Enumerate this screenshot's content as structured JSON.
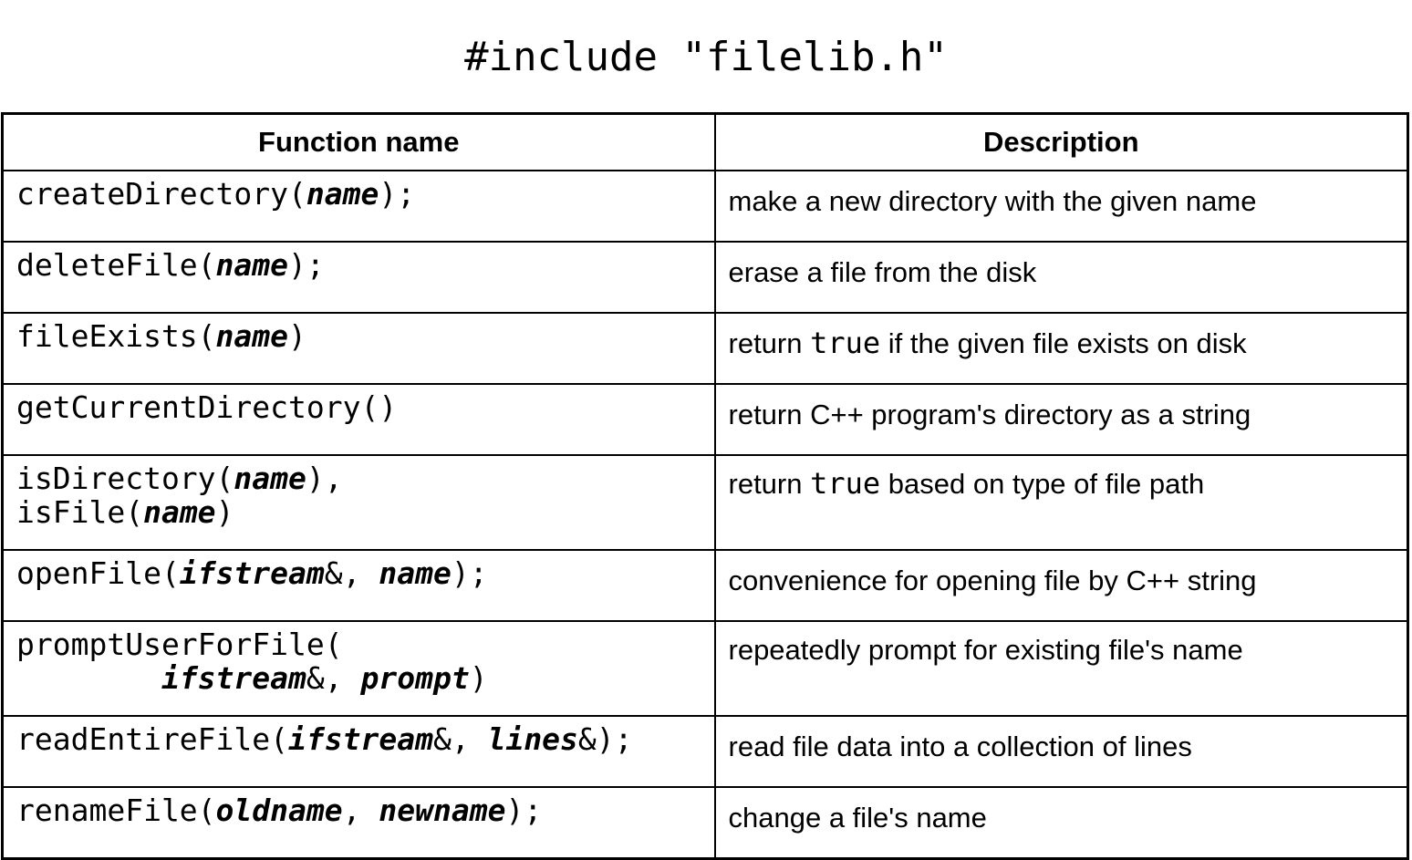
{
  "title": "#include \"filelib.h\"",
  "table": {
    "headers": {
      "function": "Function name",
      "description": "Description"
    },
    "rows": [
      {
        "fn": [
          {
            "t": "createDirectory("
          },
          {
            "t": "name",
            "p": true
          },
          {
            "t": ");"
          }
        ],
        "desc": [
          {
            "t": "make a new directory with the given name"
          }
        ]
      },
      {
        "fn": [
          {
            "t": "deleteFile("
          },
          {
            "t": "name",
            "p": true
          },
          {
            "t": ");"
          }
        ],
        "desc": [
          {
            "t": "erase a file from the disk"
          }
        ]
      },
      {
        "fn": [
          {
            "t": "fileExists("
          },
          {
            "t": "name",
            "p": true
          },
          {
            "t": ")"
          }
        ],
        "desc": [
          {
            "t": "return "
          },
          {
            "t": "true",
            "code": true
          },
          {
            "t": " if the given file exists on disk"
          }
        ]
      },
      {
        "fn": [
          {
            "t": "getCurrentDirectory()"
          }
        ],
        "desc": [
          {
            "t": "return C++ program's directory as a string"
          }
        ]
      },
      {
        "fn": [
          {
            "t": "isDirectory("
          },
          {
            "t": "name",
            "p": true
          },
          {
            "t": "),\nisFile("
          },
          {
            "t": "name",
            "p": true
          },
          {
            "t": ")"
          }
        ],
        "desc": [
          {
            "t": "return "
          },
          {
            "t": "true",
            "code": true
          },
          {
            "t": " based on type of file path"
          }
        ],
        "tall": true
      },
      {
        "fn": [
          {
            "t": "openFile("
          },
          {
            "t": "ifstream",
            "p": true
          },
          {
            "t": "&, "
          },
          {
            "t": "name",
            "p": true
          },
          {
            "t": ");"
          }
        ],
        "desc": [
          {
            "t": "convenience for opening file by C++ string"
          }
        ]
      },
      {
        "fn": [
          {
            "t": "promptUserForFile(\n        "
          },
          {
            "t": "ifstream",
            "p": true
          },
          {
            "t": "&, "
          },
          {
            "t": "prompt",
            "p": true
          },
          {
            "t": ")"
          }
        ],
        "desc": [
          {
            "t": "repeatedly prompt for existing file's name"
          }
        ],
        "tall": true
      },
      {
        "fn": [
          {
            "t": "readEntireFile("
          },
          {
            "t": "ifstream",
            "p": true
          },
          {
            "t": "&, "
          },
          {
            "t": "lines",
            "p": true
          },
          {
            "t": "&);"
          }
        ],
        "desc": [
          {
            "t": "read file data into a collection of lines"
          }
        ]
      },
      {
        "fn": [
          {
            "t": "renameFile("
          },
          {
            "t": "oldname",
            "p": true
          },
          {
            "t": ", "
          },
          {
            "t": "newname",
            "p": true
          },
          {
            "t": ");"
          }
        ],
        "desc": [
          {
            "t": "change a file's name"
          }
        ]
      }
    ]
  }
}
